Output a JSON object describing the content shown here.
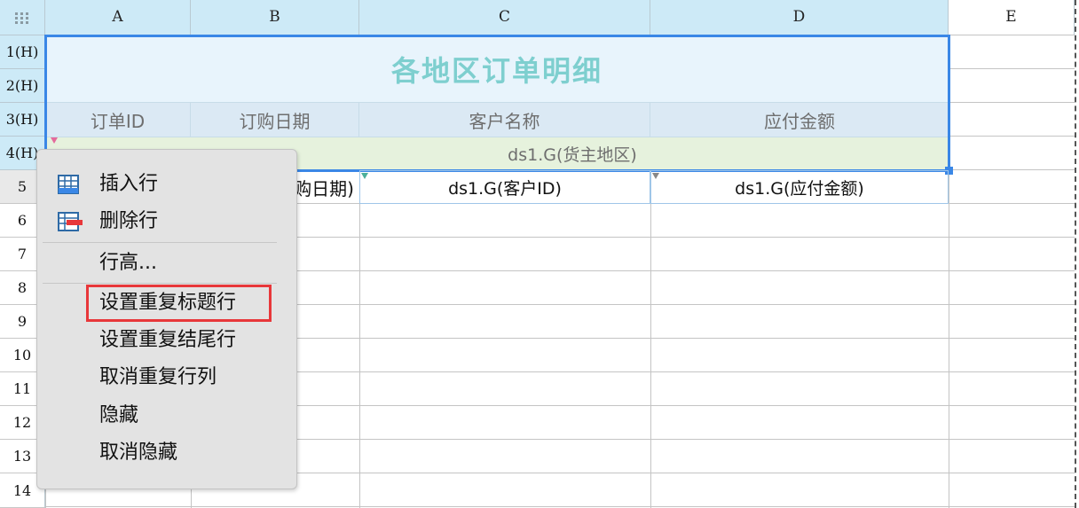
{
  "corner_icon": "grid-dots-icon",
  "columns": [
    "A",
    "B",
    "C",
    "D",
    "E"
  ],
  "rows": [
    "1(H)",
    "2(H)",
    "3(H)",
    "4(H)",
    "5",
    "6",
    "7",
    "8",
    "9",
    "10",
    "11",
    "12",
    "13",
    "14"
  ],
  "report": {
    "title": "各地区订单明细",
    "headers": [
      "订单ID",
      "订购日期",
      "客户名称",
      "应付金额"
    ],
    "group_row": "ds1.G(货主地区)",
    "row5": {
      "b_partial": "购日期)",
      "c": "ds1.G(客户ID)",
      "d": "ds1.G(应付金额)"
    }
  },
  "context_menu": {
    "items": [
      {
        "label": "插入行",
        "icon": "insert-row-icon"
      },
      {
        "label": "删除行",
        "icon": "delete-row-icon"
      },
      {
        "label": "行高...",
        "icon": ""
      },
      {
        "label": "设置重复标题行",
        "icon": "",
        "highlighted": true
      },
      {
        "label": "设置重复结尾行",
        "icon": ""
      },
      {
        "label": "取消重复行列",
        "icon": ""
      },
      {
        "label": "隐藏",
        "icon": ""
      },
      {
        "label": "取消隐藏",
        "icon": ""
      }
    ]
  },
  "colors": {
    "header_bg": "#cdeaf7",
    "selection_border": "#3a87e6",
    "title_color": "#7ecfcf",
    "group_row_bg": "#e6f2dd",
    "highlight_border": "#e8373a"
  }
}
